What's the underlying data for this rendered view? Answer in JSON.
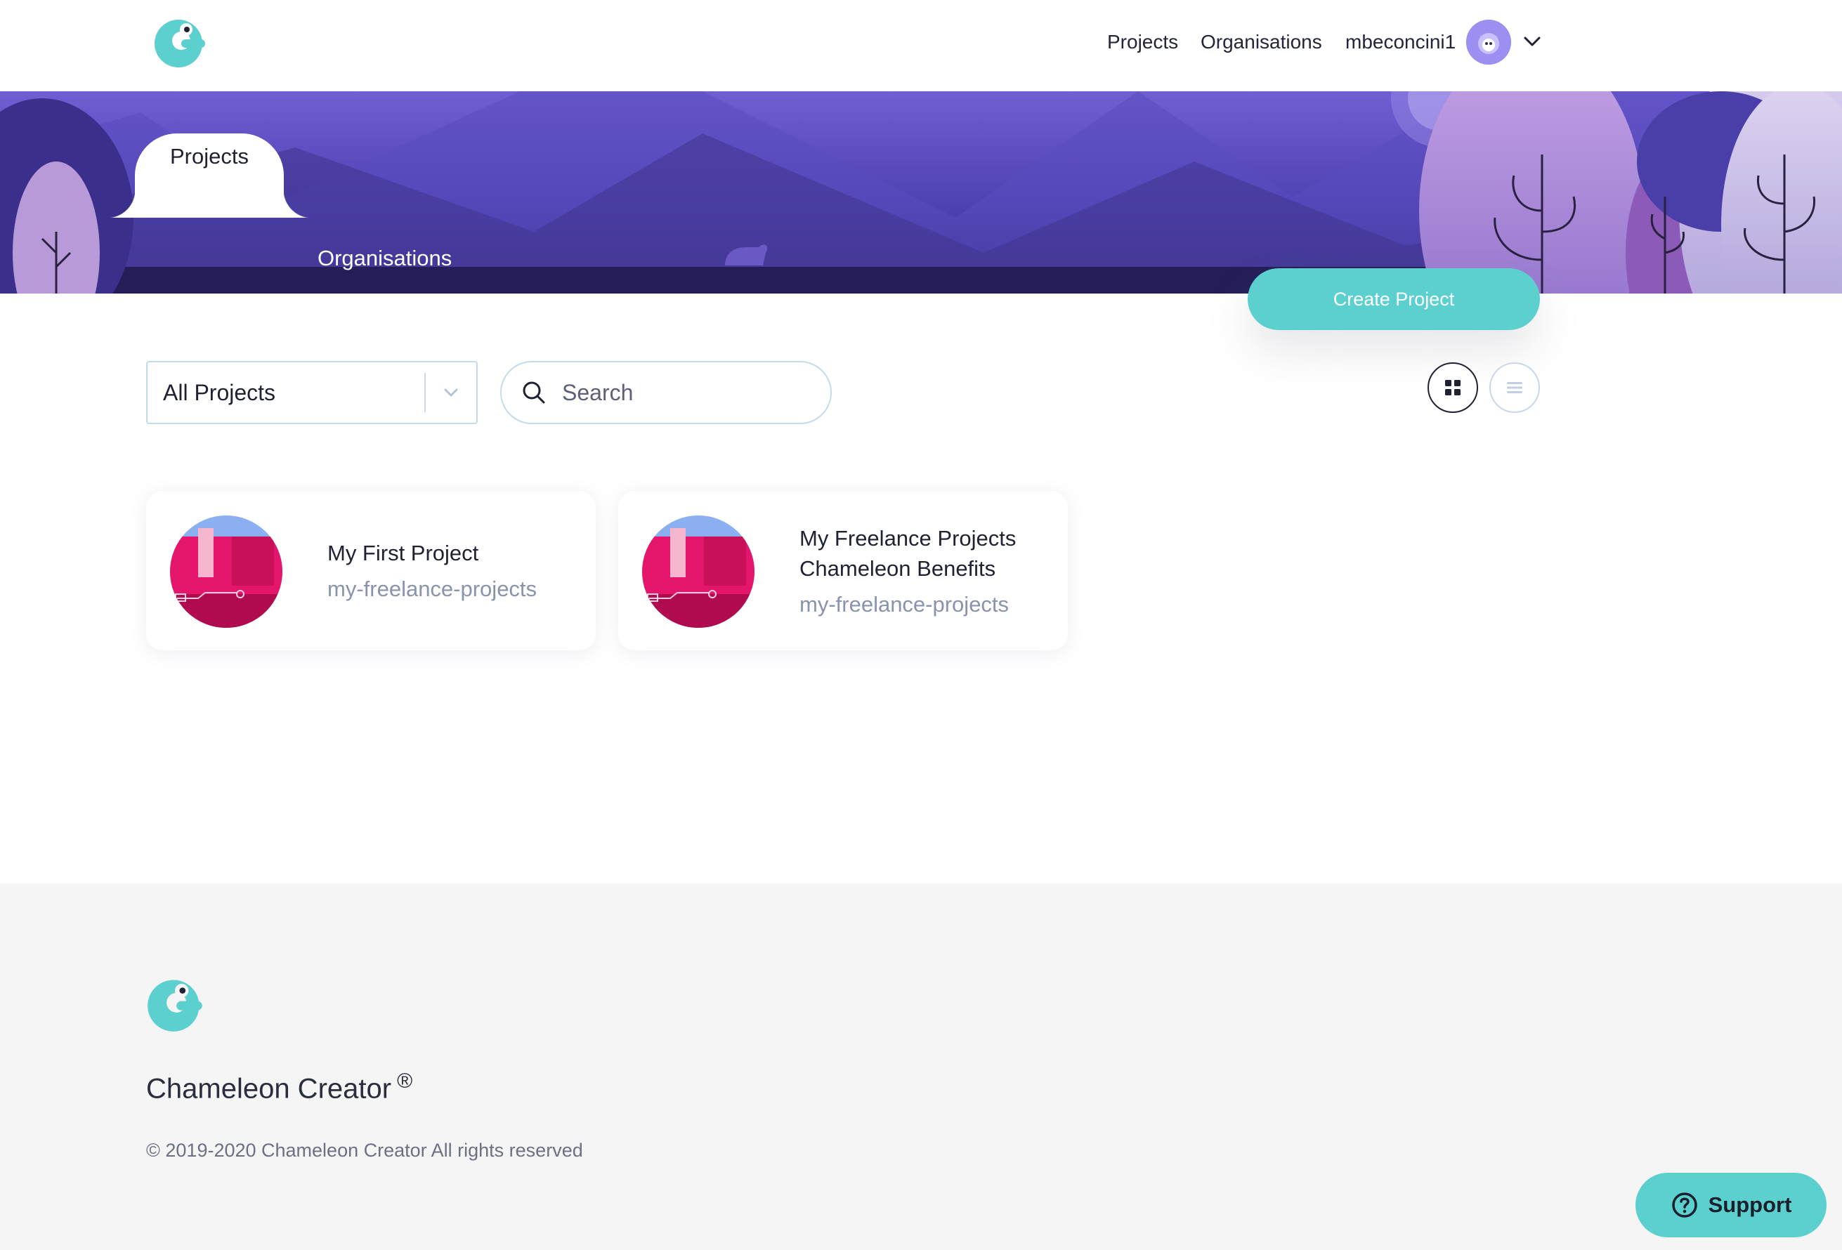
{
  "header": {
    "logo_icon": "chameleon-logo-icon",
    "nav": {
      "projects": "Projects",
      "organisations": "Organisations"
    },
    "user": {
      "username": "mbeconcini1",
      "avatar_icon": "user-avatar-icon",
      "menu_icon": "chevron-down-icon"
    }
  },
  "tabs": [
    {
      "label": "Projects",
      "active": true
    },
    {
      "label": "Organisations",
      "active": false
    }
  ],
  "actions": {
    "create_project": "Create Project"
  },
  "filters": {
    "project_filter": {
      "selected": "All Projects"
    },
    "search": {
      "placeholder": "Search",
      "value": ""
    },
    "view_modes": {
      "grid_icon": "grid-view-icon",
      "list_icon": "list-view-icon",
      "selected": "grid"
    }
  },
  "projects": [
    {
      "title": "My First Project",
      "slug": "my-freelance-projects"
    },
    {
      "title": "My Freelance Projects Chameleon Benefits",
      "slug": "my-freelance-projects"
    }
  ],
  "footer": {
    "brand": "Chameleon Creator",
    "registered_mark": "®",
    "copyright": "© 2019-2020 Chameleon Creator All rights reserved"
  },
  "support": {
    "label": "Support",
    "icon": "help-circle-icon"
  },
  "colors": {
    "accent": "#5ccfcf",
    "hero_purple": "#5b4fc4",
    "text": "#1f2233",
    "muted": "#8a93ad",
    "border": "#c3dcec"
  }
}
